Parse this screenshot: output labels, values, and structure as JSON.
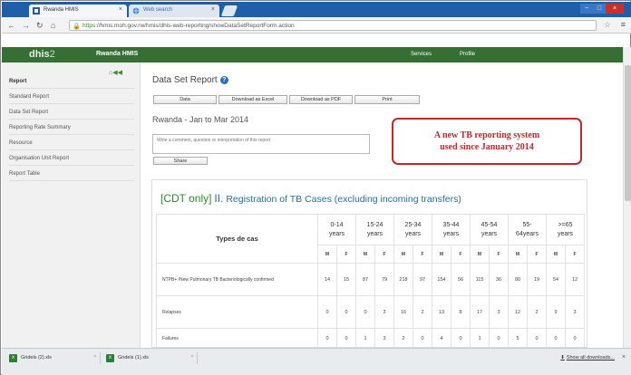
{
  "browser": {
    "tabs": [
      {
        "title": "Rwanda HMIS",
        "close": "×"
      },
      {
        "title": "Web search",
        "close": "×"
      }
    ],
    "window_buttons": {
      "minimize": "−",
      "maximize": "□",
      "close": "×"
    },
    "url_scheme": "https",
    "url_rest": "://hmis.moh.gov.rw/hmis/dhis-web-reporting/showDataSetReportForm.action",
    "icons": {
      "back": "arrow-left-icon",
      "forward": "arrow-right-icon",
      "reload": "reload-icon",
      "home": "home-icon",
      "lock": "lock-icon",
      "star": "star-icon",
      "menu": "hamburger-icon"
    }
  },
  "app": {
    "logo_main": "dhis",
    "logo_suffix": "2",
    "brand": "Rwanda HMIS",
    "nav": [
      {
        "label": "Services"
      },
      {
        "label": "Profile"
      }
    ],
    "colors": {
      "header": "#356f33",
      "accent": "#2a6f9b",
      "callout": "#c0282d"
    }
  },
  "sidebar": {
    "heading": "Report",
    "items": [
      {
        "label": "Standard Report"
      },
      {
        "label": "Data Set Report"
      },
      {
        "label": "Reporting Rate Summary"
      },
      {
        "label": "Resource"
      },
      {
        "label": "Organisation Unit Report"
      },
      {
        "label": "Report Table"
      }
    ]
  },
  "report": {
    "title": "Data Set Report",
    "buttons": [
      {
        "label": "Data"
      },
      {
        "label": "Download as Excel"
      },
      {
        "label": "Download as PDF"
      },
      {
        "label": "Print"
      }
    ],
    "period": "Rwanda - Jan to Mar 2014",
    "comment_placeholder": "Write a comment, question or interpretation of this report",
    "share_label": "Share",
    "callout_line1": "A new TB reporting system",
    "callout_line2": "used since January 2014",
    "section_prefix": "[CDT only]",
    "section_roman": "II.",
    "section_title": "Registration of TB Cases (excluding incoming transfers)"
  },
  "table": {
    "type_header": "Types de cas",
    "age_groups": [
      {
        "line1": "0-14",
        "line2": "years"
      },
      {
        "line1": "15-24",
        "line2": "years"
      },
      {
        "line1": "25-34",
        "line2": "years"
      },
      {
        "line1": "35-44",
        "line2": "years"
      },
      {
        "line1": "45-54",
        "line2": "years"
      },
      {
        "line1": "55-",
        "line2": "64years"
      },
      {
        "line1": ">=65",
        "line2": "years"
      }
    ],
    "sex_labels": [
      "M",
      "F",
      "M",
      "F",
      "M",
      "F",
      "M",
      "F",
      "M",
      "F",
      "M",
      "F",
      "M",
      "F"
    ],
    "rows": [
      {
        "label": "NTPB+ /New Pulmonary TB Bacteriologically confirmed",
        "values": [
          "14",
          "15",
          "87",
          "79",
          "218",
          "97",
          "154",
          "56",
          "115",
          "36",
          "80",
          "19",
          "54",
          "12"
        ]
      },
      {
        "label": "Relapses",
        "values": [
          "0",
          "0",
          "0",
          "3",
          "16",
          "2",
          "13",
          "8",
          "17",
          "3",
          "12",
          "2",
          "9",
          "3"
        ]
      },
      {
        "label": "Failures",
        "values": [
          "0",
          "0",
          "1",
          "3",
          "2",
          "0",
          "4",
          "0",
          "1",
          "0",
          "5",
          "0",
          "0",
          "0"
        ]
      }
    ]
  },
  "downloads": {
    "items": [
      {
        "name": "Gridels (2).xls"
      },
      {
        "name": "Gridels (1).xls"
      }
    ],
    "show_all": "Show all downloads...",
    "close": "×"
  }
}
